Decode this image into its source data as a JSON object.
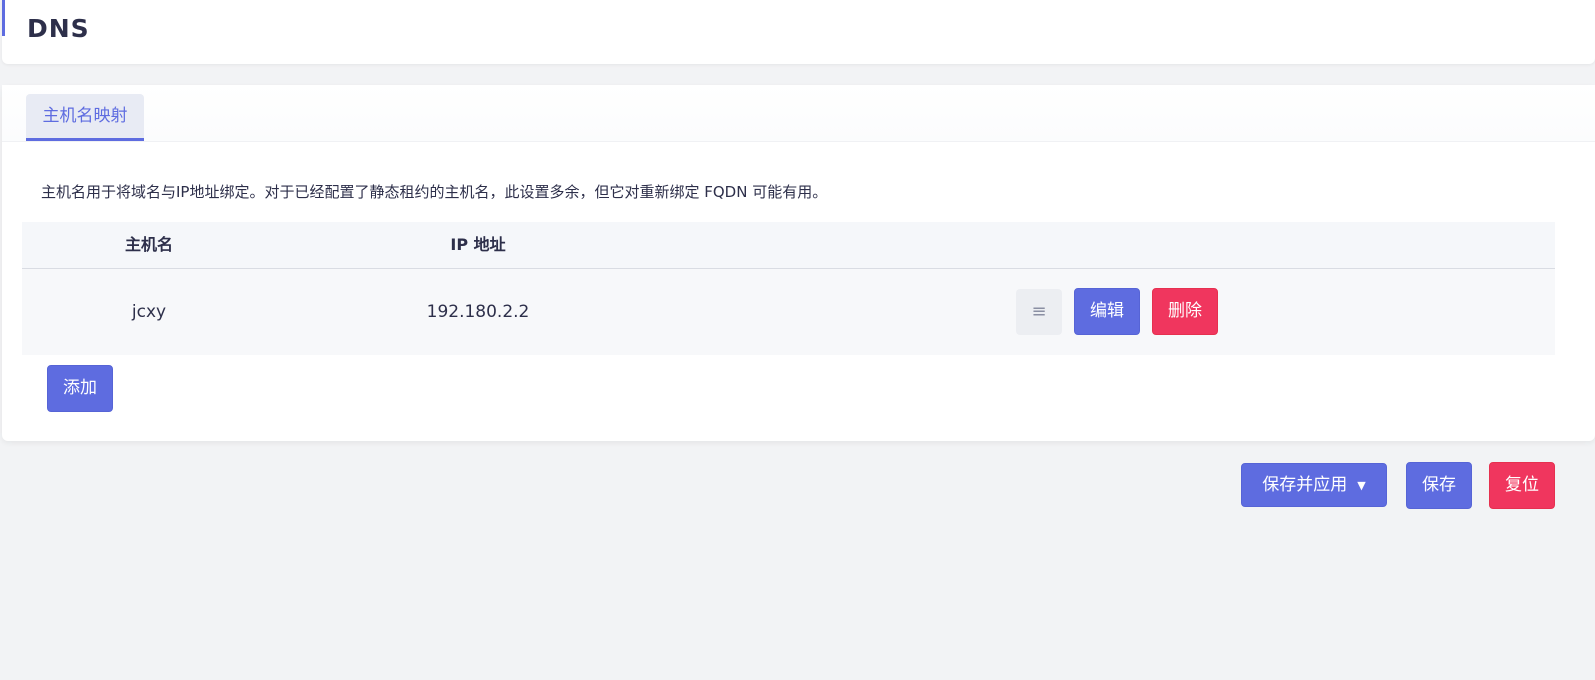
{
  "header": {
    "title": "DNS"
  },
  "tabs": [
    {
      "label": "主机名映射",
      "active": true
    }
  ],
  "section": {
    "description": "主机名用于将域名与IP地址绑定。对于已经配置了静态租约的主机名，此设置多余，但它对重新绑定 FQDN 可能有用。"
  },
  "table": {
    "columns": [
      "主机名",
      "IP 地址"
    ],
    "rows": [
      {
        "hostname": "jcxy",
        "ip": "192.180.2.2",
        "drag_icon": "≡",
        "edit_label": "编辑",
        "delete_label": "删除"
      }
    ]
  },
  "actions": {
    "add_label": "添加",
    "save_apply_label": "保存并应用",
    "save_apply_caret": "▼",
    "save_label": "保存",
    "reset_label": "复位"
  },
  "colors": {
    "primary": "#5e6ce0",
    "danger": "#f0365e",
    "background": "#f2f3f5"
  },
  "icons": {
    "drag_handle": "drag-handle-icon",
    "dropdown": "caret-down-icon"
  }
}
